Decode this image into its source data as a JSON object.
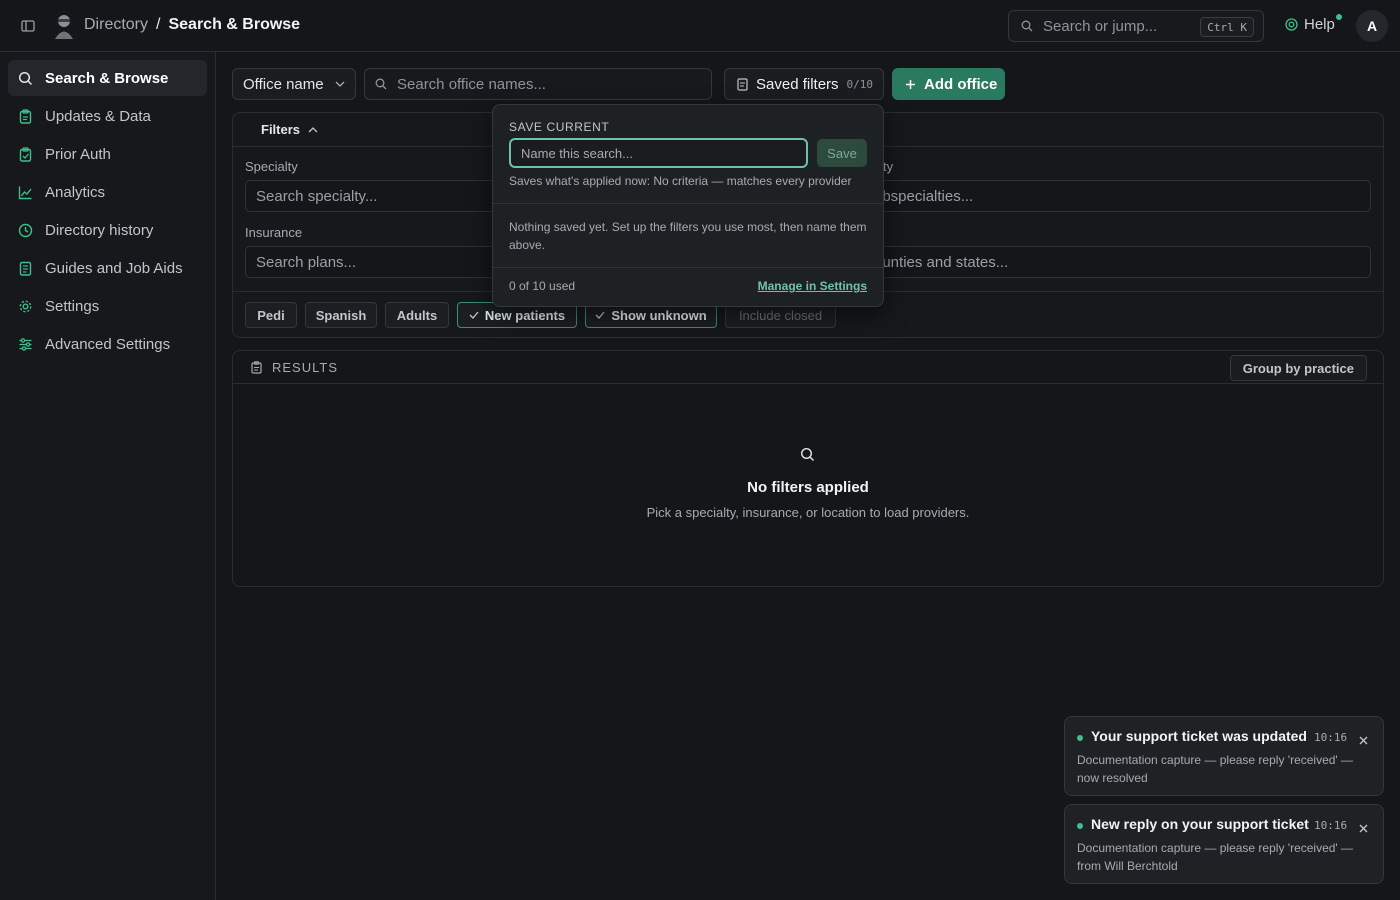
{
  "breadcrumb": {
    "root": "Directory",
    "separator": "/",
    "current": "Search & Browse"
  },
  "global_search": {
    "placeholder": "Search or jump...",
    "shortcut": "Ctrl K"
  },
  "help": {
    "label": "Help"
  },
  "user": {
    "initial": "A"
  },
  "sidebar": {
    "items": [
      {
        "label": "Search & Browse",
        "icon": "search-icon",
        "active": true
      },
      {
        "label": "Updates & Data",
        "icon": "clipboard-icon"
      },
      {
        "label": "Prior Auth",
        "icon": "clipboard-check-icon"
      },
      {
        "label": "Analytics",
        "icon": "line-chart-icon"
      },
      {
        "label": "Directory history",
        "icon": "clock-icon"
      },
      {
        "label": "Guides and Job Aids",
        "icon": "document-icon"
      },
      {
        "label": "Settings",
        "icon": "gear-icon"
      },
      {
        "label": "Advanced Settings",
        "icon": "sliders-icon"
      }
    ]
  },
  "toolbar": {
    "search_mode": "Office name",
    "office_search_placeholder": "Search office names...",
    "saved_filters_label": "Saved filters",
    "saved_filters_count": "0/10",
    "add_office_label": "Add office"
  },
  "filters": {
    "header": "Filters",
    "specialty_label": "Specialty",
    "specialty_placeholder": "Search specialty...",
    "subspecialty_label_fragment": "ty",
    "subspecialty_placeholder_fragment": "ubspecialties...",
    "insurance_label": "Insurance",
    "insurance_placeholder": "Search plans...",
    "location_placeholder_fragment": "ounties and states...",
    "chips": [
      {
        "label": "Pedi",
        "state": "default"
      },
      {
        "label": "Spanish",
        "state": "default"
      },
      {
        "label": "Adults",
        "state": "default"
      },
      {
        "label": "New patients",
        "state": "on"
      },
      {
        "label": "Show unknown",
        "state": "on"
      },
      {
        "label": "Include closed",
        "state": "off"
      }
    ]
  },
  "results": {
    "header": "RESULTS",
    "group_by_label": "Group by practice",
    "empty_title": "No filters applied",
    "empty_subtitle": "Pick a specialty, insurance, or location to load providers."
  },
  "save_popover": {
    "title": "SAVE CURRENT",
    "name_placeholder": "Name this search...",
    "save_label": "Save",
    "hint": "Saves what's applied now: No criteria — matches every provider",
    "empty_message": "Nothing saved yet. Set up the filters you use most, then name them above.",
    "usage": "0 of 10 used",
    "manage_link": "Manage in Settings"
  },
  "toasts": [
    {
      "title": "Your support ticket was updated",
      "time": "10:16",
      "body": "Documentation capture — please reply 'received' — now resolved"
    },
    {
      "title": "New reply on your support ticket",
      "time": "10:16",
      "body": "Documentation capture — please reply 'received' — from Will Berchtold"
    }
  ],
  "colors": {
    "accent": "#2a7a5f",
    "accent_light": "#6fc3a3",
    "notification_dot": "#3fbf8a",
    "background": "#141619"
  }
}
